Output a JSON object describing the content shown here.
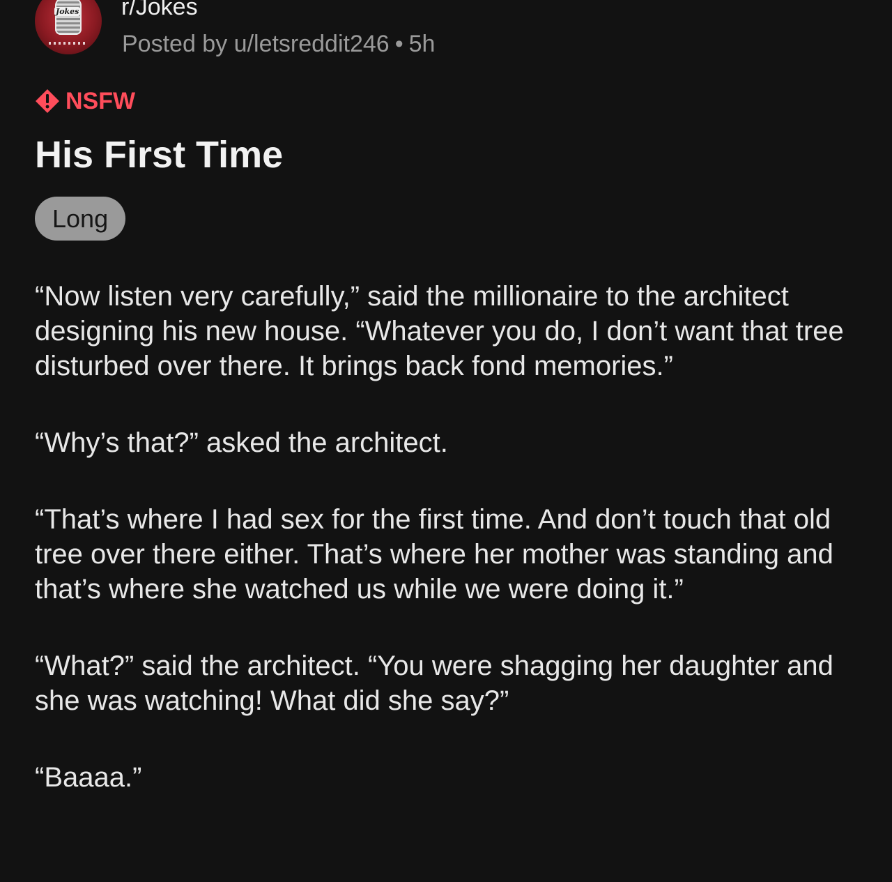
{
  "post": {
    "subreddit": "r/Jokes",
    "posted_by": "Posted by u/letsreddit246",
    "separator": "•",
    "age": "5h",
    "avatar_label": "Jokes",
    "nsfw_label": "NSFW",
    "title": "His First Time",
    "flair": "Long",
    "paragraphs": [
      "“Now listen very carefully,” said the millionaire to the architect designing his new house. “Whatever you do, I don’t want that tree disturbed over there. It brings back fond memories.”",
      "“Why’s that?” asked the architect.",
      "“That’s where I had sex for the first time. And don’t touch that old tree over there either. That’s where her mother was standing and that’s where she watched us while we were doing it.”",
      "“What?” said the architect. “You were shagging her daughter and she was watching! What did she say?”",
      "“Baaaa.”"
    ]
  },
  "colors": {
    "background": "#121212",
    "nsfw": "#ff4d5b",
    "meta_text": "#9a9a9a",
    "flair_bg": "#9a9a9a"
  },
  "icons": {
    "avatar": "subreddit-avatar-microphone",
    "nsfw": "nsfw-warning-diamond-icon"
  }
}
